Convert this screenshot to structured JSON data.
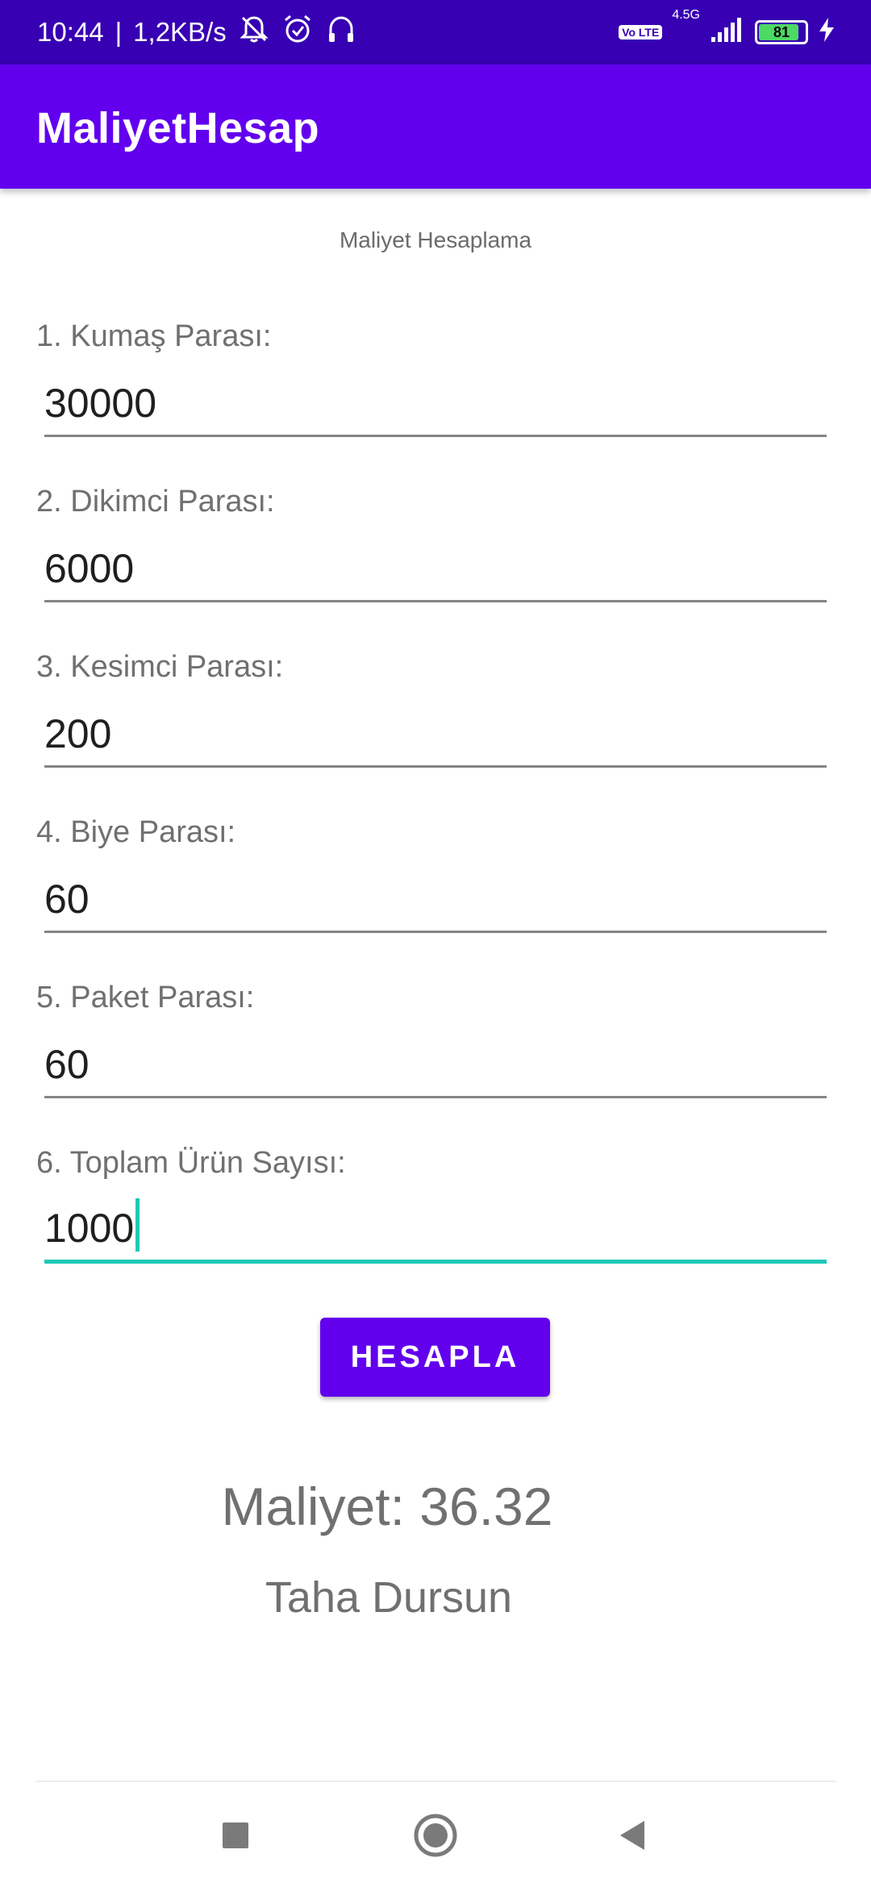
{
  "status_bar": {
    "time": "10:44",
    "separator": "|",
    "speed": "1,2KB/s",
    "network_badge": "Vo LTE",
    "network_type": "4.5G",
    "battery_level": "81",
    "icons": [
      "bell-off-icon",
      "alarm-icon",
      "headphones-icon",
      "volte-icon",
      "signal-icon",
      "battery-icon",
      "charging-icon"
    ]
  },
  "app_bar": {
    "title": "MaliyetHesap"
  },
  "form": {
    "subtitle": "Maliyet Hesaplama",
    "fields": [
      {
        "label": "1. Kumaş Parası:",
        "value": "30000"
      },
      {
        "label": "2. Dikimci Parası:",
        "value": "6000"
      },
      {
        "label": "3. Kesimci Parası:",
        "value": "200"
      },
      {
        "label": "4. Biye Parası:",
        "value": "60"
      },
      {
        "label": "5. Paket Parası:",
        "value": "60"
      },
      {
        "label": "6. Toplam Ürün Sayısı:",
        "value": "1000",
        "focused": true
      }
    ],
    "button_label": "HESAPLA"
  },
  "result": {
    "text": "Maliyet: 36.32",
    "author": "Taha Dursun"
  },
  "nav_bar": {
    "icons": [
      "recents-icon",
      "home-icon",
      "back-icon"
    ]
  },
  "colors": {
    "status_bar": "#3700b3",
    "primary": "#6200ee",
    "focus_accent": "#1fc7b6",
    "label_text": "#707070"
  }
}
